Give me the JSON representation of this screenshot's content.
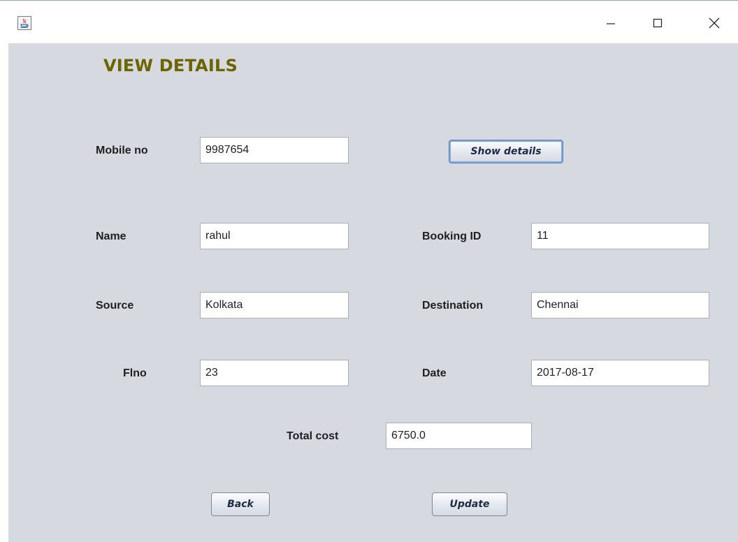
{
  "window": {
    "icon": "java-app-icon",
    "controls": {
      "minimize": "minimize-icon",
      "maximize": "maximize-icon",
      "close": "close-icon"
    }
  },
  "page": {
    "title": "VIEW DETAILS"
  },
  "form": {
    "mobile": {
      "label": "Mobile no",
      "value": "9987654"
    },
    "show_details_label": "Show details",
    "name": {
      "label": "Name",
      "value": "rahul"
    },
    "booking_id": {
      "label": "Booking ID",
      "value": "11"
    },
    "source": {
      "label": "Source",
      "value": "Kolkata"
    },
    "destination": {
      "label": "Destination",
      "value": "Chennai"
    },
    "flno": {
      "label": "Flno",
      "value": "23"
    },
    "date": {
      "label": "Date",
      "value": "2017-08-17"
    },
    "total_cost": {
      "label": "Total cost",
      "value": "6750.0"
    }
  },
  "actions": {
    "back_label": "Back",
    "update_label": "Update"
  },
  "colors": {
    "background": "#d6d9e0",
    "title": "#6b6500"
  }
}
